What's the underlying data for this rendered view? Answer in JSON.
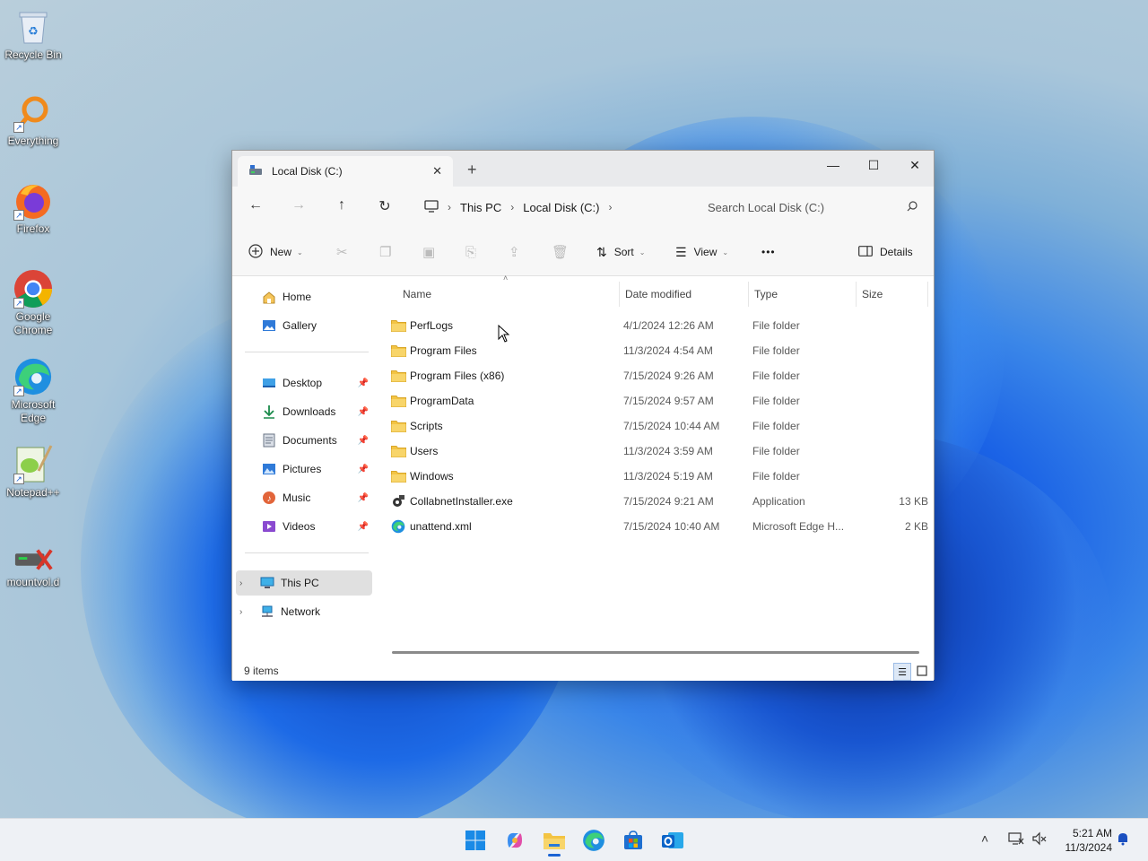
{
  "desktop": {
    "icons": [
      {
        "label": "Recycle Bin"
      },
      {
        "label": "Everything"
      },
      {
        "label": "Firefox"
      },
      {
        "label": "Google Chrome"
      },
      {
        "label": "Microsoft Edge"
      },
      {
        "label": "Notepad++"
      },
      {
        "label": "mountvol.d"
      }
    ]
  },
  "window": {
    "tab_title": "Local Disk (C:)",
    "tab_close": "✕",
    "new_tab": "+",
    "controls": {
      "minimize": "—",
      "maximize": "☐",
      "close": "✕"
    }
  },
  "navbar": {
    "back": "←",
    "forward": "→",
    "up": "↑",
    "refresh": "↻",
    "breadcrumbs": [
      "This PC",
      "Local Disk (C:)"
    ],
    "search_placeholder": "Search Local Disk (C:)"
  },
  "toolbar": {
    "new_label": "New",
    "sort_label": "Sort",
    "view_label": "View",
    "more_label": "•••",
    "details_label": "Details"
  },
  "sidebar": {
    "home": "Home",
    "gallery": "Gallery",
    "pinned": [
      "Desktop",
      "Downloads",
      "Documents",
      "Pictures",
      "Music",
      "Videos"
    ],
    "this_pc": "This PC",
    "network": "Network"
  },
  "columns": {
    "name": "Name",
    "date": "Date modified",
    "type": "Type",
    "size": "Size"
  },
  "files": [
    {
      "name": "PerfLogs",
      "date": "4/1/2024 12:26 AM",
      "type": "File folder",
      "size": "",
      "icon": "folder-icon"
    },
    {
      "name": "Program Files",
      "date": "11/3/2024 4:54 AM",
      "type": "File folder",
      "size": "",
      "icon": "folder-icon"
    },
    {
      "name": "Program Files (x86)",
      "date": "7/15/2024 9:26 AM",
      "type": "File folder",
      "size": "",
      "icon": "folder-icon"
    },
    {
      "name": "ProgramData",
      "date": "7/15/2024 9:57 AM",
      "type": "File folder",
      "size": "",
      "icon": "folder-icon"
    },
    {
      "name": "Scripts",
      "date": "7/15/2024 10:44 AM",
      "type": "File folder",
      "size": "",
      "icon": "folder-icon"
    },
    {
      "name": "Users",
      "date": "11/3/2024 3:59 AM",
      "type": "File folder",
      "size": "",
      "icon": "folder-icon"
    },
    {
      "name": "Windows",
      "date": "11/3/2024 5:19 AM",
      "type": "File folder",
      "size": "",
      "icon": "folder-icon"
    },
    {
      "name": "CollabnetInstaller.exe",
      "date": "7/15/2024 9:21 AM",
      "type": "Application",
      "size": "13 KB",
      "icon": "application-icon"
    },
    {
      "name": "unattend.xml",
      "date": "7/15/2024 10:40 AM",
      "type": "Microsoft Edge H...",
      "size": "2 KB",
      "icon": "edge-icon"
    }
  ],
  "status": {
    "item_count": "9 items"
  },
  "taskbar": {
    "apps": [
      "start-icon",
      "copilot-icon",
      "file-explorer-icon",
      "edge-icon",
      "store-icon",
      "outlook-icon"
    ],
    "clock_time": "5:21 AM",
    "clock_date": "11/3/2024"
  },
  "colors": {
    "accent": "#1a63d4",
    "folder": "#f3c443"
  }
}
